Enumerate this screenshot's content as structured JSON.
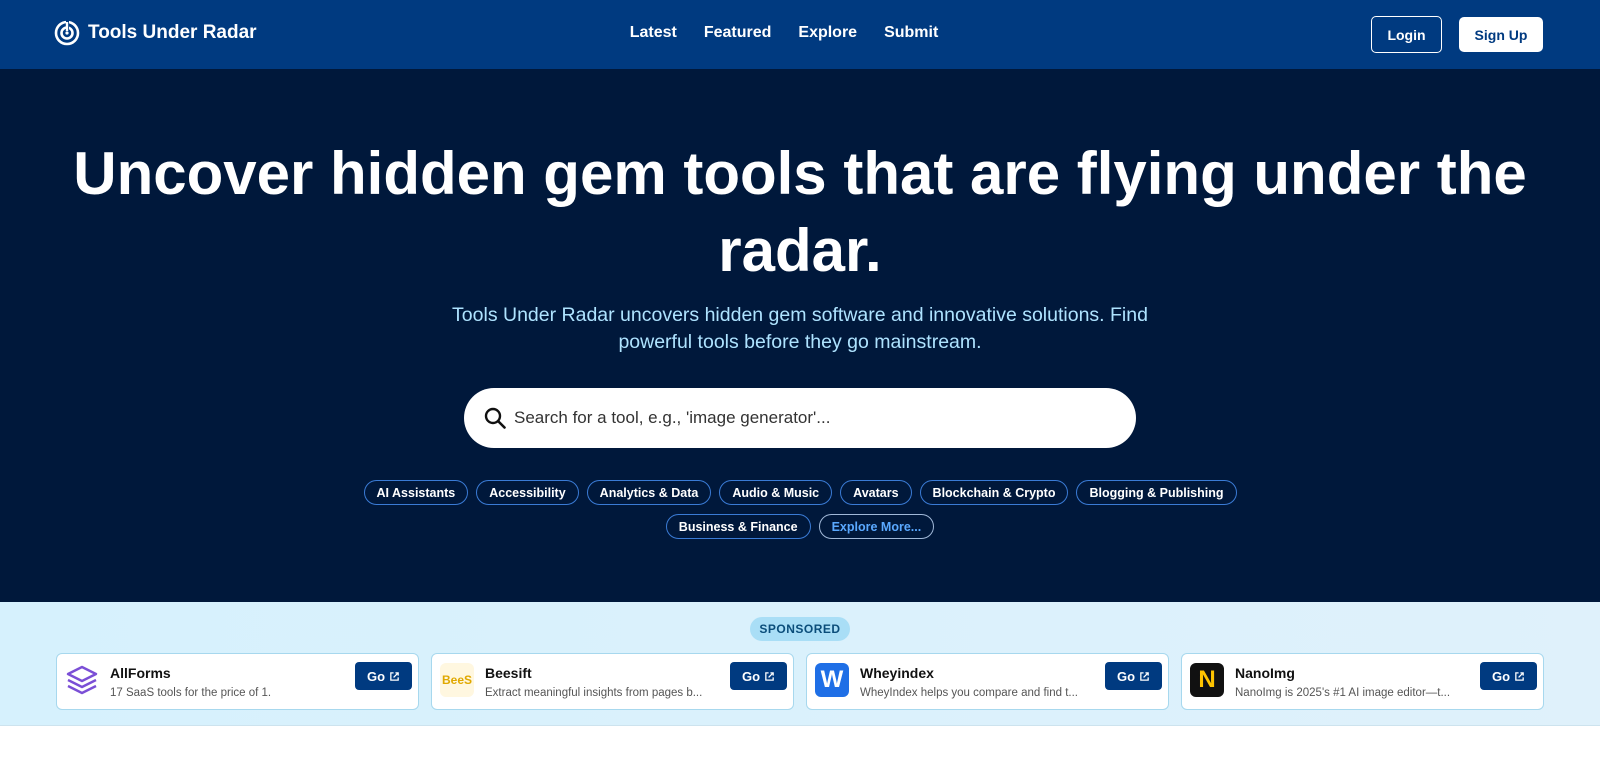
{
  "header": {
    "brand": "Tools Under Radar",
    "nav": [
      "Latest",
      "Featured",
      "Explore",
      "Submit"
    ],
    "login": "Login",
    "signup": "Sign Up"
  },
  "hero": {
    "title": "Uncover hidden gem tools that are flying under the radar.",
    "subtitle": "Tools Under Radar uncovers hidden gem software and innovative solutions. Find powerful tools before they go mainstream.",
    "search_placeholder": "Search for a tool, e.g., 'image generator'...",
    "tags": [
      "AI Assistants",
      "Accessibility",
      "Analytics & Data",
      "Audio & Music",
      "Avatars",
      "Blockchain & Crypto",
      "Blogging & Publishing",
      "Business & Finance"
    ],
    "explore_more": "Explore More..."
  },
  "sponsored": {
    "label": "SPONSORED",
    "cards": [
      {
        "name": "AllForms",
        "desc": "17 SaaS tools for the price of 1.",
        "logo_icon": "stacked-layers-icon",
        "logo_text": "",
        "go": "Go"
      },
      {
        "name": "Beesift",
        "desc": "Extract meaningful insights from pages b...",
        "logo_icon": "beesift-logo",
        "logo_text": "BeeS",
        "go": "Go"
      },
      {
        "name": "Wheyindex",
        "desc": "WheyIndex helps you compare and find t...",
        "logo_icon": "wheyindex-logo",
        "logo_text": "W",
        "go": "Go"
      },
      {
        "name": "NanoImg",
        "desc": "NanoImg is 2025's #1 AI image editor—t...",
        "logo_icon": "nanoimg-logo",
        "logo_text": "N",
        "go": "Go"
      }
    ]
  },
  "colors": {
    "nav_bg": "#003a80",
    "hero_bg": "#00183b",
    "subtitle": "#aee3ff",
    "accent_link": "#5aa9ff"
  }
}
